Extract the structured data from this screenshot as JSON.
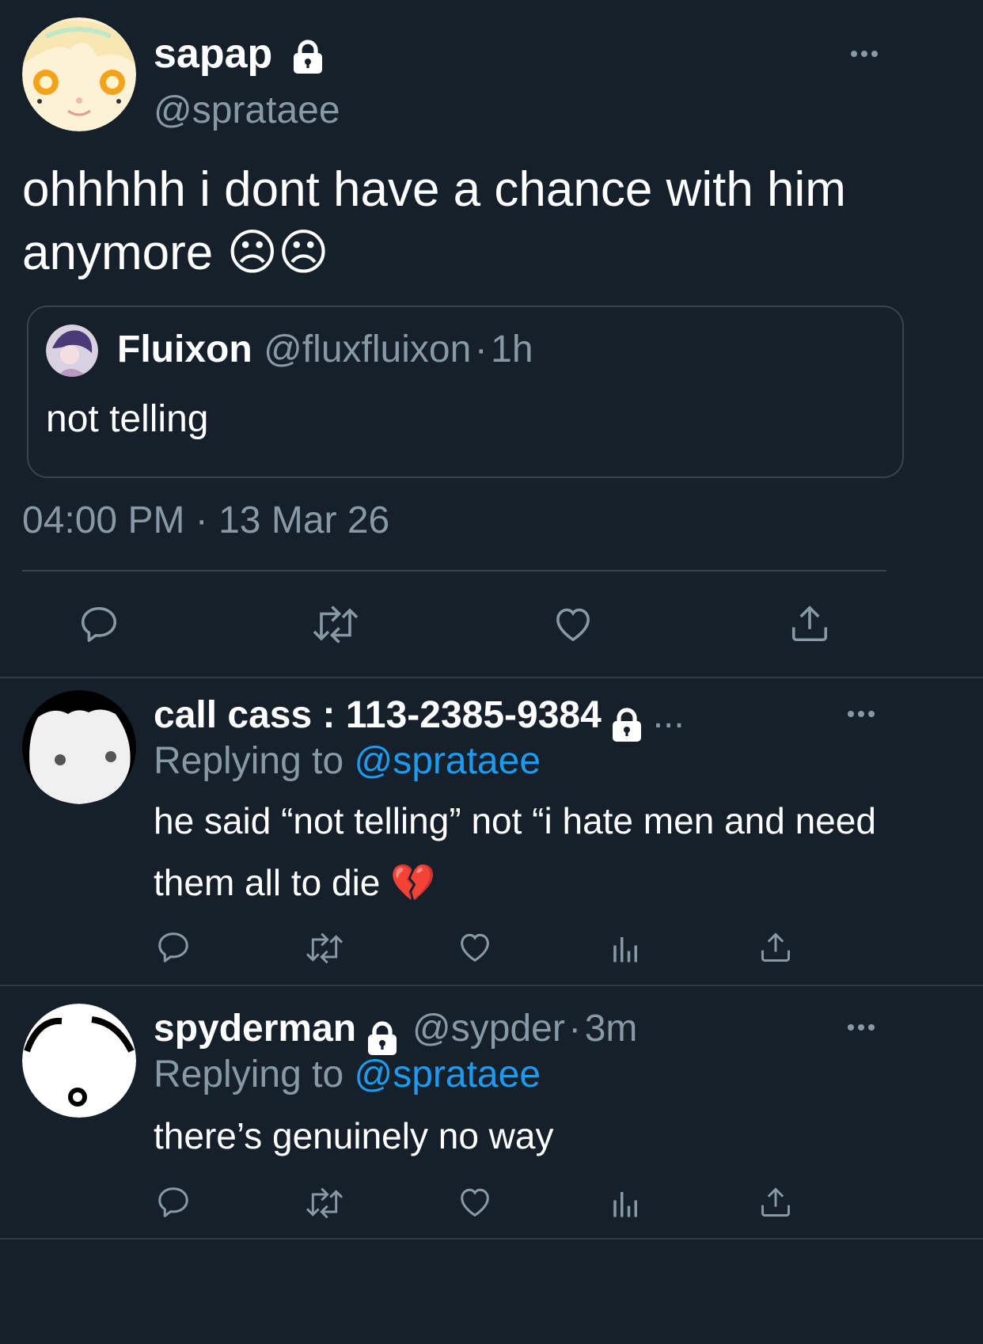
{
  "main_tweet": {
    "display_name": "sapap",
    "handle": "@sprataee",
    "text": "ohhhhh i dont have a chance with him anymore ☹☹",
    "quoted": {
      "display_name": "Fluixon",
      "handle": "@fluxfluixon",
      "separator": "·",
      "time": "1h",
      "text": "not telling"
    },
    "timestamp": "04:00 PM · 13 Mar 26",
    "actions": [
      "reply-icon",
      "retweet-icon",
      "like-icon",
      "share-icon"
    ]
  },
  "replies": [
    {
      "display_name": "call cass : 113-2385-9384",
      "name_suffix": "...",
      "replying_label": "Replying to",
      "replying_handle": "@sprataee",
      "text": "he said “not telling” not “i hate men and need them all to die 💔",
      "actions": [
        "reply-icon",
        "retweet-icon",
        "like-icon",
        "analytics-icon",
        "share-icon"
      ]
    },
    {
      "display_name": "spyderman",
      "handle": "@sypder",
      "separator": "·",
      "time": "3m",
      "replying_label": "Replying to",
      "replying_handle": "@sprataee",
      "text": "there’s genuinely no way",
      "actions": [
        "reply-icon",
        "retweet-icon",
        "like-icon",
        "analytics-icon",
        "share-icon"
      ]
    }
  ],
  "colors": {
    "background": "#15202b",
    "text": "#ffffff",
    "muted": "#8899a6",
    "accent": "#1d9bf0",
    "border": "#38444d"
  }
}
